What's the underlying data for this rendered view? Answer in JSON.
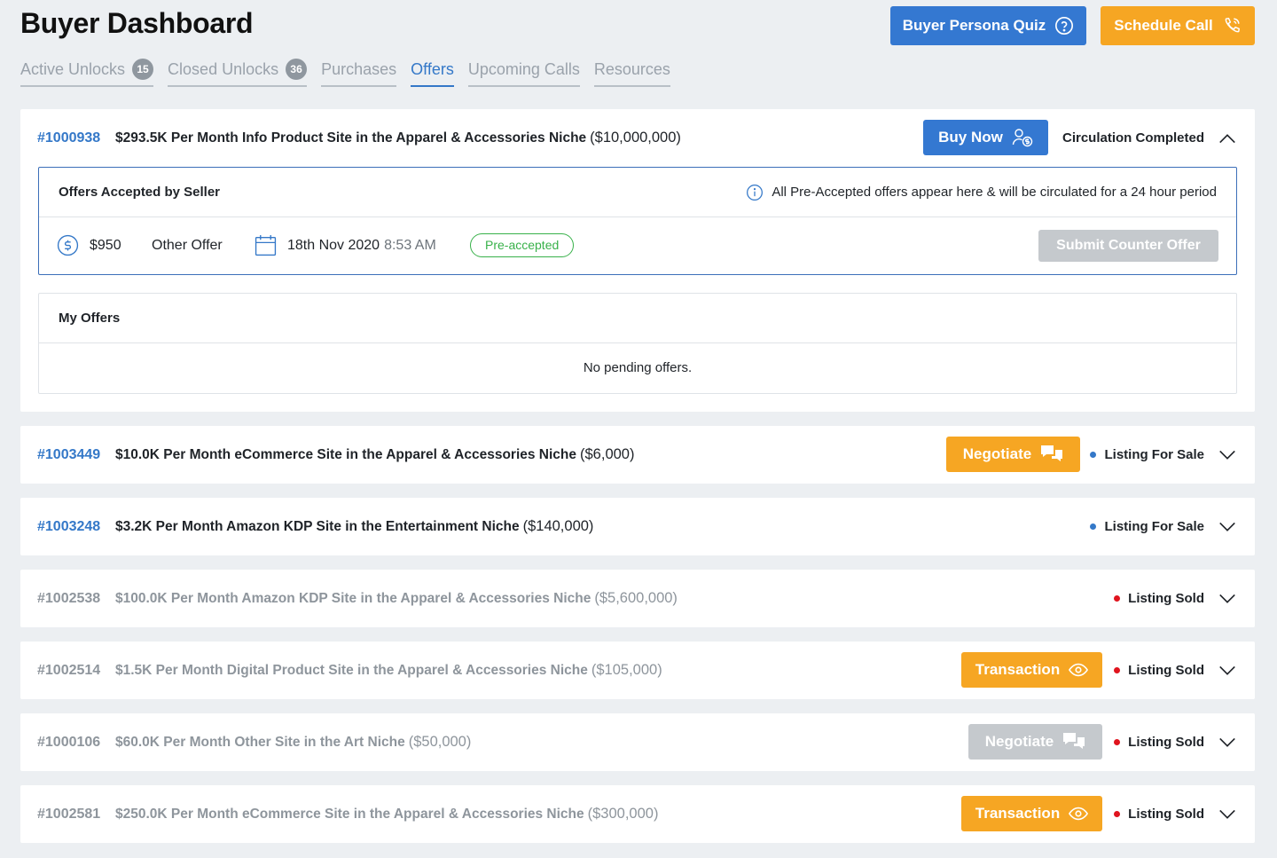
{
  "header": {
    "title": "Buyer Dashboard",
    "quiz_label": "Buyer Persona Quiz",
    "call_label": "Schedule Call",
    "tabs": [
      {
        "label": "Active Unlocks",
        "badge": "15"
      },
      {
        "label": "Closed Unlocks",
        "badge": "36"
      },
      {
        "label": "Purchases"
      },
      {
        "label": "Offers",
        "active": true
      },
      {
        "label": "Upcoming Calls"
      },
      {
        "label": "Resources"
      }
    ]
  },
  "expanded": {
    "id": "#1000938",
    "title": "$293.5K Per Month Info Product Site in the Apparel & Accessories Niche",
    "price": "($10,000,000)",
    "button": "Buy Now",
    "status": "Circulation Completed",
    "accepted": {
      "title": "Offers Accepted by Seller",
      "info": "All Pre-Accepted offers appear here & will be circulated for a 24 hour period",
      "amount": "$950",
      "type": "Other Offer",
      "date": "18th Nov 2020",
      "time": "8:53 AM",
      "badge": "Pre-accepted",
      "counter_button": "Submit Counter Offer"
    },
    "my_offers": {
      "title": "My Offers",
      "empty": "No pending offers."
    }
  },
  "listings": [
    {
      "id": "#1003449",
      "title": "$10.0K Per Month eCommerce Site in the Apparel & Accessories Niche",
      "price": "($6,000)",
      "button": "Negotiate",
      "status": "Listing For Sale"
    },
    {
      "id": "#1003248",
      "title": "$3.2K Per Month Amazon KDP Site in the Entertainment Niche",
      "price": "($140,000)",
      "status": "Listing For Sale"
    },
    {
      "id": "#1002538",
      "title": "$100.0K Per Month Amazon KDP Site in the Apparel & Accessories Niche",
      "price": "($5,600,000)",
      "status": "Listing Sold"
    },
    {
      "id": "#1002514",
      "title": "$1.5K Per Month Digital Product Site in the Apparel & Accessories Niche",
      "price": "($105,000)",
      "button": "Transaction",
      "status": "Listing Sold"
    },
    {
      "id": "#1000106",
      "title": "$60.0K Per Month Other Site in the Art Niche",
      "price": "($50,000)",
      "button": "Negotiate",
      "status": "Listing Sold"
    },
    {
      "id": "#1002581",
      "title": "$250.0K Per Month eCommerce Site in the Apparel & Accessories Niche",
      "price": "($300,000)",
      "button": "Transaction",
      "status": "Listing Sold"
    }
  ],
  "colors": {
    "primary_blue": "#3478d1",
    "accent_orange": "#f6a623",
    "disabled_gray": "#c5c9cd",
    "for_sale_dot": "#3478c8",
    "sold_dot": "#e0141e",
    "pre_accepted_green": "#38b14a"
  }
}
